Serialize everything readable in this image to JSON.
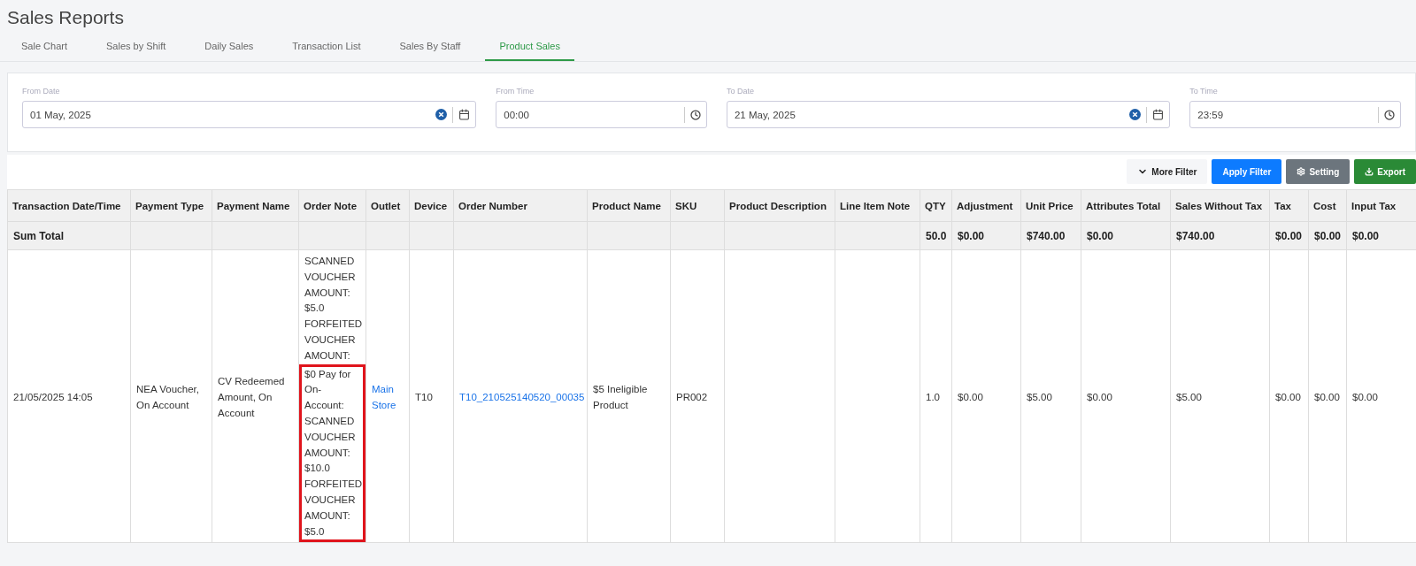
{
  "title": "Sales Reports",
  "tabs": [
    {
      "label": "Sale Chart",
      "selected": false
    },
    {
      "label": "Sales by Shift",
      "selected": false
    },
    {
      "label": "Daily Sales",
      "selected": false
    },
    {
      "label": "Transaction List",
      "selected": false
    },
    {
      "label": "Sales By Staff",
      "selected": false
    },
    {
      "label": "Product Sales",
      "selected": true
    }
  ],
  "filters": [
    {
      "label": "From Date",
      "value": "01 May, 2025",
      "kind": "date"
    },
    {
      "label": "From Time",
      "value": "00:00",
      "kind": "time"
    },
    {
      "label": "To Date",
      "value": "21 May, 2025",
      "kind": "date"
    },
    {
      "label": "To Time",
      "value": "23:59",
      "kind": "time"
    }
  ],
  "buttons": [
    {
      "label": "More Filter",
      "kind": "more"
    },
    {
      "label": "Apply Filter",
      "kind": "apply"
    },
    {
      "label": "Setting",
      "kind": "setting"
    },
    {
      "label": "Export",
      "kind": "export"
    }
  ],
  "table": {
    "columns": [
      "Transaction Date/Time",
      "Payment Type",
      "Payment Name",
      "Order Note",
      "Outlet",
      "Device",
      "Order Number",
      "Product Name",
      "SKU",
      "Product Description",
      "Line Item Note",
      "QTY",
      "Adjustment",
      "Unit Price",
      "Attributes Total",
      "Sales Without Tax",
      "Tax",
      "Cost",
      "Input Tax"
    ],
    "sum_row": [
      {
        "kind": "text",
        "text": "Sum Total"
      },
      {
        "kind": "empty"
      },
      {
        "kind": "empty"
      },
      {
        "kind": "empty"
      },
      {
        "kind": "empty"
      },
      {
        "kind": "empty"
      },
      {
        "kind": "empty"
      },
      {
        "kind": "empty"
      },
      {
        "kind": "empty"
      },
      {
        "kind": "empty"
      },
      {
        "kind": "empty"
      },
      {
        "kind": "text",
        "text": "50.0"
      },
      {
        "kind": "text",
        "text": "$0.00"
      },
      {
        "kind": "text",
        "text": "$740.00"
      },
      {
        "kind": "text",
        "text": "$0.00"
      },
      {
        "kind": "text",
        "text": "$740.00"
      },
      {
        "kind": "text",
        "text": "$0.00"
      },
      {
        "kind": "text",
        "text": "$0.00"
      },
      {
        "kind": "text",
        "text": "$0.00"
      }
    ],
    "rows": [
      [
        {
          "kind": "text",
          "text": "21/05/2025 14:05"
        },
        {
          "kind": "text",
          "text": "NEA Voucher, On Account"
        },
        {
          "kind": "text",
          "text": "CV Redeemed Amount, On Account"
        },
        {
          "kind": "note",
          "parts": [
            {
              "text": "SCANNED VOUCHER AMOUNT: $5.0 FORFEITED VOUCHER AMOUNT:",
              "highlighted": false
            },
            {
              "text": "$0 Pay for On-Account: SCANNED VOUCHER AMOUNT: $10.0 FORFEITED VOUCHER AMOUNT: $5.0",
              "highlighted": true
            }
          ]
        },
        {
          "kind": "link",
          "text": "Main Store"
        },
        {
          "kind": "text",
          "text": "T10"
        },
        {
          "kind": "link",
          "text": "T10_210525140520_00035"
        },
        {
          "kind": "text",
          "text": "$5 Ineligible Product"
        },
        {
          "kind": "text",
          "text": "PR002"
        },
        {
          "kind": "empty"
        },
        {
          "kind": "empty"
        },
        {
          "kind": "text",
          "text": "1.0"
        },
        {
          "kind": "text",
          "text": "$0.00"
        },
        {
          "kind": "text",
          "text": "$5.00"
        },
        {
          "kind": "text",
          "text": "$0.00"
        },
        {
          "kind": "text",
          "text": "$5.00"
        },
        {
          "kind": "text",
          "text": "$0.00"
        },
        {
          "kind": "text",
          "text": "$0.00"
        },
        {
          "kind": "text",
          "text": "$0.00"
        }
      ]
    ]
  }
}
